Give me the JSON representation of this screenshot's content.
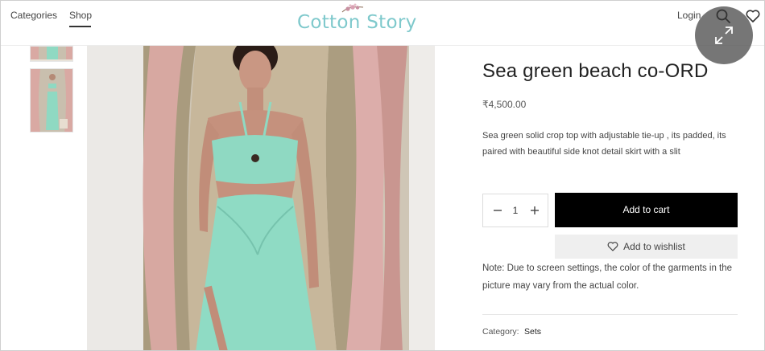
{
  "header": {
    "nav": [
      {
        "label": "Categories"
      },
      {
        "label": "Shop"
      }
    ],
    "logo_text": "Cotton Story",
    "login_label": "Login"
  },
  "product": {
    "title": "Sea green beach co-ORD",
    "price": "₹4,500.00",
    "description": "Sea green solid crop top with adjustable tie-up , its padded, its paired with beautiful side knot detail skirt with a slit",
    "quantity": "1",
    "add_to_cart_label": "Add to cart",
    "wishlist_label": "Add to wishlist",
    "note": "Note: Due to screen settings, the color of the garments in the picture may vary from the actual color.",
    "category_label": "Category:",
    "category_value": "Sets"
  },
  "colors": {
    "logo": "#7fc9cc",
    "dress": "#8fd9c2",
    "curtain_pink": "#d9a9a3",
    "curtain_beige": "#a99b7e",
    "button_dark": "#000000"
  },
  "icons": [
    "search-icon",
    "heart-icon",
    "expand-icon",
    "minus-icon",
    "plus-icon"
  ]
}
